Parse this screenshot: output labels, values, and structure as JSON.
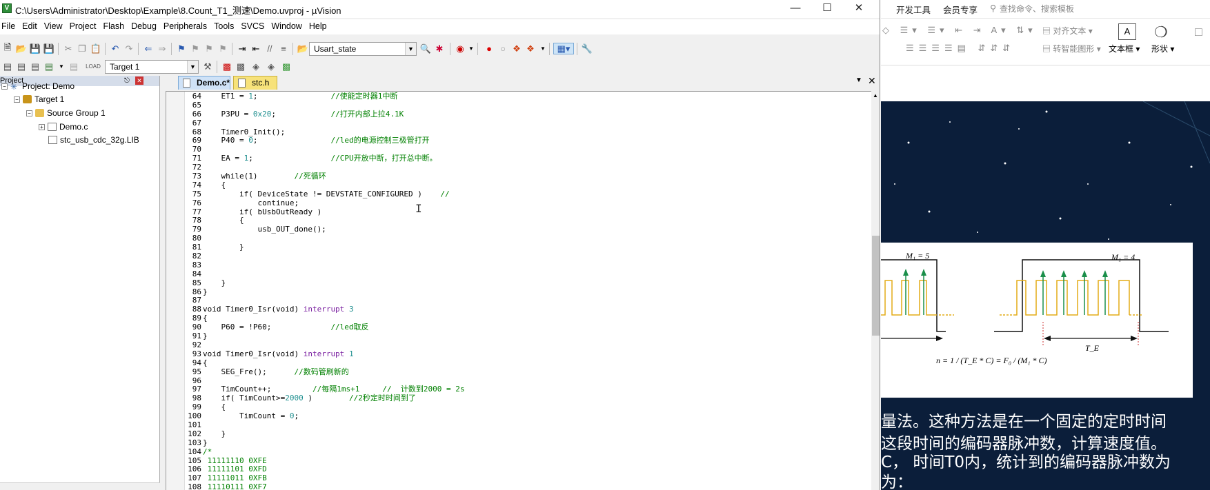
{
  "window": {
    "title": "C:\\Users\\Administrator\\Desktop\\Example\\8.Count_T1_测速\\Demo.uvproj - µVision"
  },
  "menu": [
    "File",
    "Edit",
    "View",
    "Project",
    "Flash",
    "Debug",
    "Peripherals",
    "Tools",
    "SVCS",
    "Window",
    "Help"
  ],
  "toolbar": {
    "find_combo": "Usart_state",
    "target_combo": "Target 1"
  },
  "project": {
    "panel_title": "Project",
    "root": "Project: Demo",
    "target": "Target 1",
    "group": "Source Group 1",
    "files": [
      "Demo.c",
      "stc_usb_cdc_32g.LIB"
    ]
  },
  "editor": {
    "tabs": [
      "Demo.c*",
      "stc.h"
    ],
    "lines": [
      {
        "n": "64",
        "t": "    ET1 = 1;                //使能定时器1中断"
      },
      {
        "n": "65",
        "t": ""
      },
      {
        "n": "66",
        "t": "    P3PU = 0x20;            //打开内部上拉4.1K"
      },
      {
        "n": "67",
        "t": ""
      },
      {
        "n": "68",
        "t": "    Timer0_Init();"
      },
      {
        "n": "69",
        "t": "    P40 = 0;                //led的电源控制三极管打开"
      },
      {
        "n": "70",
        "t": ""
      },
      {
        "n": "71",
        "t": "    EA = 1;                 //CPU开放中断，打开总中断。"
      },
      {
        "n": "72",
        "t": ""
      },
      {
        "n": "73",
        "t": "    while(1)        //死循环"
      },
      {
        "n": "74",
        "t": "    {"
      },
      {
        "n": "75",
        "t": "        if( DeviceState != DEVSTATE_CONFIGURED )    //"
      },
      {
        "n": "76",
        "t": "            continue;"
      },
      {
        "n": "77",
        "t": "        if( bUsbOutReady )"
      },
      {
        "n": "78",
        "t": "        {"
      },
      {
        "n": "79",
        "t": "            usb_OUT_done();"
      },
      {
        "n": "80",
        "t": ""
      },
      {
        "n": "81",
        "t": "        }"
      },
      {
        "n": "82",
        "t": ""
      },
      {
        "n": "83",
        "t": ""
      },
      {
        "n": "84",
        "t": ""
      },
      {
        "n": "85",
        "t": "    }"
      },
      {
        "n": "86",
        "t": "}"
      },
      {
        "n": "87",
        "t": ""
      },
      {
        "n": "88",
        "t": "void Timer0_Isr(void) interrupt 3"
      },
      {
        "n": "89",
        "t": "{"
      },
      {
        "n": "90",
        "t": "    P60 = !P60;             //led取反"
      },
      {
        "n": "91",
        "t": "}"
      },
      {
        "n": "92",
        "t": ""
      },
      {
        "n": "93",
        "t": "void Timer0_Isr(void) interrupt 1"
      },
      {
        "n": "94",
        "t": "{"
      },
      {
        "n": "95",
        "t": "    SEG_Fre();      //数码管刷新的"
      },
      {
        "n": "96",
        "t": ""
      },
      {
        "n": "97",
        "t": "    TimCount++;         //每隔1ms+1     //  计数到2000 = 2s"
      },
      {
        "n": "98",
        "t": "    if( TimCount>=2000 )        //2秒定时时间到了"
      },
      {
        "n": "99",
        "t": "    {"
      },
      {
        "n": "100",
        "t": "        TimCount = 0;"
      },
      {
        "n": "101",
        "t": ""
      },
      {
        "n": "102",
        "t": "    }"
      },
      {
        "n": "103",
        "t": "}"
      },
      {
        "n": "104",
        "t": "/*"
      },
      {
        "n": "105",
        "t": " 11111110 0XFE"
      },
      {
        "n": "106",
        "t": " 11111101 0XFD"
      },
      {
        "n": "107",
        "t": " 11111011 0XFB"
      },
      {
        "n": "108",
        "t": " 11110111 0XF7"
      }
    ]
  },
  "wps": {
    "tabs": [
      "开发工具",
      "会员专享"
    ],
    "search_placeholder": "查找命令、搜索模板",
    "ribbon": {
      "align_text": "对齐文本",
      "smart_shape": "转智能图形",
      "textbox": "文本框",
      "shape": "形状"
    },
    "diagram": {
      "m1_left": "M₁ = 5",
      "m1_right": "M₁ = 4",
      "te": "T_E",
      "formula": "n = 1 / (T_E * C) = F₀ / (M₁ * C)"
    },
    "text_lines": [
      "量法。这种方法是在一个固定的定时时间",
      "这段时间的编码器脉冲数，计算速度值。",
      "C， 时间T0内，统计到的编码器脉冲数为",
      "为："
    ]
  }
}
